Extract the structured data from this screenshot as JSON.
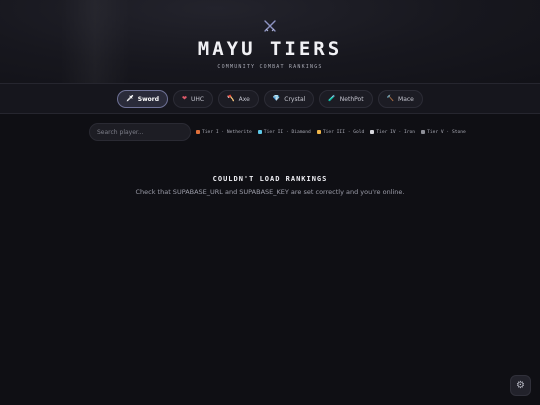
{
  "header": {
    "logo_icon": "crossed-swords-icon",
    "title": "Mayu Tiers",
    "subtitle": "Community Combat Rankings"
  },
  "tabs": [
    {
      "label": "Sword",
      "icon": "sword-icon",
      "glyph": "🗡",
      "active": true
    },
    {
      "label": "UHC",
      "icon": "heart-icon",
      "glyph": "❤",
      "active": false
    },
    {
      "label": "Axe",
      "icon": "axe-icon",
      "glyph": "🪓",
      "active": false
    },
    {
      "label": "Crystal",
      "icon": "crystal-icon",
      "glyph": "💎",
      "active": false
    },
    {
      "label": "NethPot",
      "icon": "potion-icon",
      "glyph": "🧪",
      "active": false
    },
    {
      "label": "Mace",
      "icon": "mace-icon",
      "glyph": "🔨",
      "active": false
    }
  ],
  "search": {
    "placeholder": "Search player...",
    "value": ""
  },
  "legend": [
    {
      "label": "Tier I · Netherite",
      "color": "#e0703a"
    },
    {
      "label": "Tier II · Diamond",
      "color": "#5ec9e8"
    },
    {
      "label": "Tier III · Gold",
      "color": "#f0b64a"
    },
    {
      "label": "Tier IV · Iron",
      "color": "#d8d8de"
    },
    {
      "label": "Tier V · Stone",
      "color": "#8e8f98"
    }
  ],
  "error": {
    "title": "Couldn't load rankings",
    "message": "Check that SUPABASE_URL and SUPABASE_KEY are set correctly and you're online."
  },
  "settings": {
    "icon": "gear-icon",
    "glyph": "⚙"
  },
  "colors": {
    "background": "#0f0f14",
    "accent": "#6e7196"
  }
}
